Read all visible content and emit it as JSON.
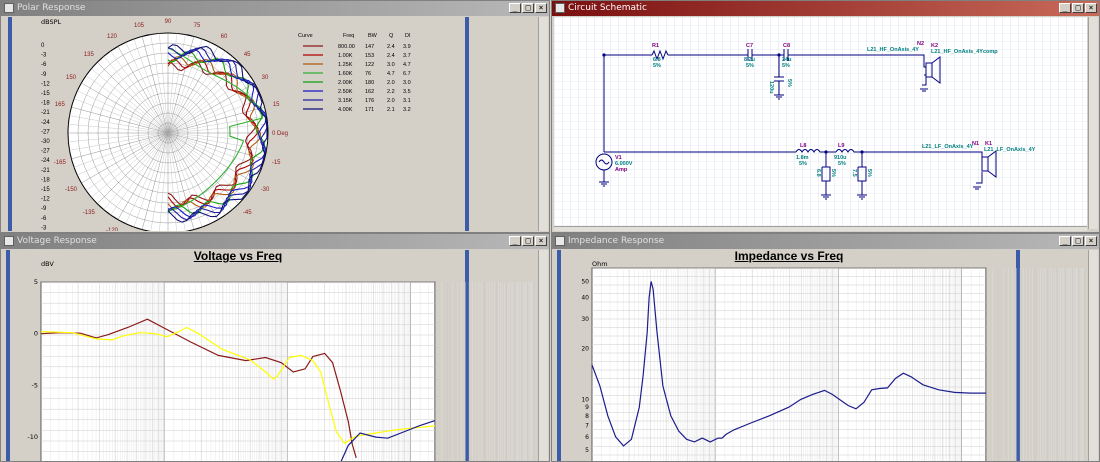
{
  "windows": {
    "polar": {
      "title": "Polar Response"
    },
    "schematic": {
      "title": "Circuit Schematic"
    },
    "voltage": {
      "title": "Voltage Response"
    },
    "impedance": {
      "title": "Impedance Response"
    }
  },
  "window_buttons": {
    "minimize": "_",
    "maximize": "□",
    "close": "×"
  },
  "colors": {
    "titlebar_active": "#7a0f0f",
    "titlebar_inactive": "#808080",
    "trace_blue": "#1c1c8c",
    "trace_red": "#8b1a1a",
    "trace_yellow": "#ffff00",
    "schematic_wire": "#000080",
    "label_teal": "#008080",
    "label_purple": "#800080"
  },
  "polar": {
    "unit": "dBSPL",
    "left_scale": [
      "0",
      "-3",
      "-6",
      "-9",
      "-12",
      "-15",
      "-18",
      "-21",
      "-24",
      "-27",
      "-30",
      "-27",
      "-24",
      "-21",
      "-18",
      "-15",
      "-12",
      "-9",
      "-6",
      "-3"
    ],
    "angle_labels": {
      "a90": "90",
      "a75": "75",
      "a60": "60",
      "a45": "45",
      "a30": "30",
      "a15": "15",
      "a0": "0 Deg",
      "am15": "-15",
      "am30": "-30",
      "am45": "-45",
      "a105": "105",
      "a120": "120",
      "a135": "135",
      "a150": "150",
      "a165": "165",
      "am165": "-165",
      "am150": "-150",
      "am135": "-135",
      "am120": "-120",
      "am105": "-105"
    },
    "legend_headers": {
      "curve": "Curve",
      "freq": "Freq",
      "bw": "BW",
      "q": "Q",
      "di": "DI"
    },
    "legend": [
      {
        "color": "#8b1a1a",
        "freq": "800.00",
        "bw": "147",
        "q": "2.4",
        "di": "3.9"
      },
      {
        "color": "#b00000",
        "freq": "1.00K",
        "bw": "153",
        "q": "2.4",
        "di": "3.7"
      },
      {
        "color": "#b05a10",
        "freq": "1.25K",
        "bw": "122",
        "q": "3.0",
        "di": "4.7"
      },
      {
        "color": "#30b030",
        "freq": "1.60K",
        "bw": "76",
        "q": "4.7",
        "di": "6.7"
      },
      {
        "color": "#10a010",
        "freq": "2.00K",
        "bw": "180",
        "q": "2.0",
        "di": "3.0"
      },
      {
        "color": "#1818c8",
        "freq": "2.50K",
        "bw": "162",
        "q": "2.2",
        "di": "3.5"
      },
      {
        "color": "#2020a0",
        "freq": "3.15K",
        "bw": "176",
        "q": "2.0",
        "di": "3.1"
      },
      {
        "color": "#10107a",
        "freq": "4.00K",
        "bw": "171",
        "q": "2.1",
        "di": "3.2"
      }
    ]
  },
  "schematic": {
    "r1": {
      "name": "R1",
      "value": "6.8",
      "tol": "5%"
    },
    "c7": {
      "name": "C7",
      "value": "8.2u",
      "tol": "5%"
    },
    "c8": {
      "name": "C8",
      "value": "24u",
      "tol": "5%"
    },
    "c8_shunt": {
      "value": "120u",
      "tol": "5%"
    },
    "n2_label": "N2",
    "k2_label": "K2",
    "hf_net1": "L21_HF_OnAxis_4Y",
    "hf_net2": "L21_HF_OnAxis_4Ycomp",
    "l8": {
      "name": "L8",
      "value": "1.8m",
      "tol": "5%"
    },
    "l9": {
      "name": "L9",
      "value": "910u",
      "tol": "5%"
    },
    "shunt1": {
      "value": "6.8",
      "tol": "5%"
    },
    "shunt2": {
      "value": "7.5",
      "tol": "5%"
    },
    "v1": {
      "name": "V1",
      "value": "6.000V",
      "type": "Amp"
    },
    "n1_label": "N1",
    "k1_label": "K1",
    "lf_net1": "L21_LF_OnAxis_4Y",
    "lf_net2": "L21_LF_OnAxis_4Y"
  },
  "voltage": {
    "title": "Voltage vs Freq",
    "unit": "dBV",
    "y_ticks": [
      "5",
      "0",
      "-5",
      "-10"
    ],
    "chart_data": {
      "type": "line",
      "title": "Voltage vs Freq",
      "ylabel": "dBV",
      "ylim": [
        -12.5,
        5
      ],
      "xlabel": "",
      "series": [
        {
          "color": "#8b1a1a",
          "points": [
            [
              0,
              0
            ],
            [
              0.05,
              0.1
            ],
            [
              0.1,
              0.05
            ],
            [
              0.14,
              -0.4
            ],
            [
              0.17,
              -0.1
            ],
            [
              0.22,
              0.6
            ],
            [
              0.27,
              1.4
            ],
            [
              0.31,
              0.6
            ],
            [
              0.38,
              -0.8
            ],
            [
              0.45,
              -2.1
            ],
            [
              0.52,
              -2.6
            ],
            [
              0.57,
              -2.3
            ],
            [
              0.61,
              -2.8
            ],
            [
              0.64,
              -3.7
            ],
            [
              0.67,
              -3.4
            ],
            [
              0.69,
              -2.2
            ],
            [
              0.72,
              -1.9
            ],
            [
              0.74,
              -2.8
            ],
            [
              0.76,
              -5.5
            ],
            [
              0.78,
              -8.5
            ],
            [
              0.79,
              -10.7
            ],
            [
              0.8,
              -12.0
            ]
          ]
        },
        {
          "color": "#ffff00",
          "points": [
            [
              0,
              0.2
            ],
            [
              0.08,
              0.1
            ],
            [
              0.14,
              -0.5
            ],
            [
              0.18,
              -0.6
            ],
            [
              0.21,
              -0.2
            ],
            [
              0.25,
              0.1
            ],
            [
              0.29,
              0.0
            ],
            [
              0.32,
              -0.3
            ],
            [
              0.35,
              0.2
            ],
            [
              0.37,
              0.6
            ],
            [
              0.4,
              0.0
            ],
            [
              0.46,
              -1.5
            ],
            [
              0.5,
              -2.1
            ],
            [
              0.53,
              -2.5
            ],
            [
              0.57,
              -3.7
            ],
            [
              0.59,
              -4.4
            ],
            [
              0.6,
              -4.1
            ],
            [
              0.63,
              -2.3
            ],
            [
              0.66,
              -2.1
            ],
            [
              0.69,
              -2.6
            ],
            [
              0.71,
              -3.7
            ],
            [
              0.73,
              -6.7
            ],
            [
              0.75,
              -9.5
            ],
            [
              0.77,
              -10.6
            ],
            [
              0.8,
              -9.9
            ],
            [
              0.85,
              -9.6
            ],
            [
              0.9,
              -9.3
            ],
            [
              0.95,
              -9.1
            ],
            [
              1,
              -8.9
            ]
          ]
        },
        {
          "color": "#1c1c8c",
          "points": [
            [
              0.76,
              -12.5
            ],
            [
              0.78,
              -10.8
            ],
            [
              0.81,
              -9.6
            ],
            [
              0.85,
              -10.0
            ],
            [
              0.88,
              -10.1
            ],
            [
              0.92,
              -9.5
            ],
            [
              0.96,
              -8.9
            ],
            [
              1,
              -8.4
            ]
          ]
        }
      ]
    }
  },
  "impedance": {
    "title": "Impedance vs Freq",
    "unit": "Ohm",
    "y_ticks": [
      "50",
      "40",
      "30",
      "20",
      "10",
      "9",
      "8",
      "7",
      "6",
      "5"
    ],
    "chart_data": {
      "type": "line",
      "title": "Impedance vs Freq",
      "ylabel": "Ohm",
      "yscale": "log",
      "ylim": [
        4.2,
        60
      ],
      "series": [
        {
          "color": "#1c1c8c",
          "points": [
            [
              0,
              16
            ],
            [
              0.02,
              12
            ],
            [
              0.04,
              8
            ],
            [
              0.06,
              6
            ],
            [
              0.08,
              5.3
            ],
            [
              0.1,
              5.8
            ],
            [
              0.12,
              9
            ],
            [
              0.13,
              14
            ],
            [
              0.14,
              25
            ],
            [
              0.145,
              40
            ],
            [
              0.15,
              50
            ],
            [
              0.155,
              45
            ],
            [
              0.165,
              25
            ],
            [
              0.18,
              12
            ],
            [
              0.2,
              8
            ],
            [
              0.22,
              6.5
            ],
            [
              0.24,
              5.8
            ],
            [
              0.26,
              5.6
            ],
            [
              0.28,
              5.9
            ],
            [
              0.3,
              5.6
            ],
            [
              0.32,
              5.9
            ],
            [
              0.33,
              5.9
            ],
            [
              0.34,
              6.2
            ],
            [
              0.36,
              6.6
            ],
            [
              0.4,
              7.2
            ],
            [
              0.45,
              8
            ],
            [
              0.5,
              9
            ],
            [
              0.53,
              10
            ],
            [
              0.56,
              10.7
            ],
            [
              0.59,
              11.3
            ],
            [
              0.61,
              10.7
            ],
            [
              0.65,
              9.2
            ],
            [
              0.67,
              8.8
            ],
            [
              0.69,
              9.6
            ],
            [
              0.71,
              11.4
            ],
            [
              0.73,
              11.6
            ],
            [
              0.75,
              11.7
            ],
            [
              0.77,
              13.3
            ],
            [
              0.79,
              14.3
            ],
            [
              0.81,
              13.6
            ],
            [
              0.84,
              12.2
            ],
            [
              0.88,
              11.4
            ],
            [
              0.92,
              11.0
            ],
            [
              0.96,
              10.9
            ],
            [
              1,
              10.9
            ]
          ]
        }
      ]
    }
  }
}
